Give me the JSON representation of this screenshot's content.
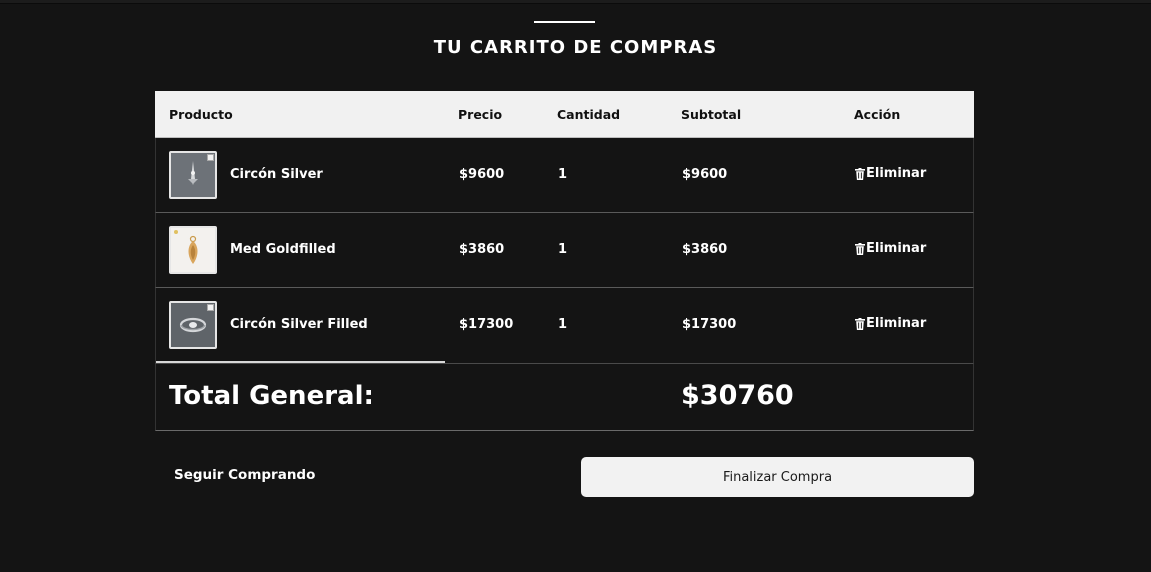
{
  "page": {
    "title": "TU CARRITO DE COMPRAS"
  },
  "table": {
    "headers": {
      "product": "Producto",
      "price": "Precio",
      "quantity": "Cantidad",
      "subtotal": "Subtotal",
      "action": "Acción"
    },
    "rows": [
      {
        "name": "Circón Silver",
        "price": "$9600",
        "quantity": "1",
        "subtotal": "$9600",
        "action": "Eliminar",
        "thumb_icon": "silver-pendant-icon"
      },
      {
        "name": "Med Goldfilled",
        "price": "$3860",
        "quantity": "1",
        "subtotal": "$3860",
        "action": "Eliminar",
        "thumb_icon": "gold-medal-icon"
      },
      {
        "name": "Circón Silver Filled",
        "price": "$17300",
        "quantity": "1",
        "subtotal": "$17300",
        "action": "Eliminar",
        "thumb_icon": "silver-ring-icon"
      }
    ],
    "total": {
      "label": "Total General:",
      "value": "$30760"
    }
  },
  "actions": {
    "continue_label": "Seguir Comprando",
    "checkout_label": "Finalizar Compra"
  },
  "colors": {
    "background": "#141414",
    "header_bg": "#f1f1f1",
    "button_bg": "#f2f2f2",
    "text": "#ffffff"
  }
}
